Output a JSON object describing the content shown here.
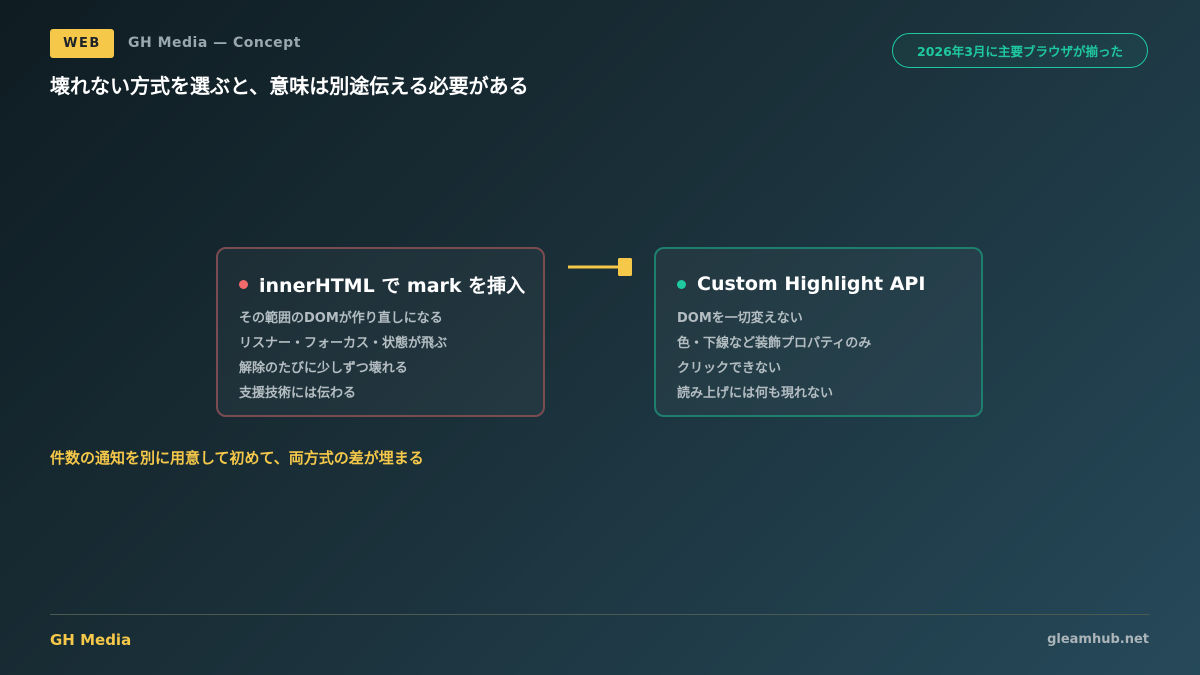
{
  "header": {
    "tag": "WEB",
    "source": "GH Media — Concept",
    "title": "壊れない方式を選ぶと、意味は別途伝える必要がある",
    "badge": "2026年3月に主要ブラウザが揃った"
  },
  "cards": {
    "left": {
      "title": "innerHTML で mark を挿入",
      "accent": "#f26b6b",
      "items": [
        "その範囲のDOMが作り直しになる",
        "リスナー・フォーカス・状態が飛ぶ",
        "解除のたびに少しずつ壊れる",
        "支援技術には伝わる"
      ]
    },
    "right": {
      "title": "Custom Highlight API",
      "accent": "#1fc9a0",
      "items": [
        "DOMを一切変えない",
        "色・下線など装飾プロパティのみ",
        "クリックできない",
        "読み上げには何も現れない"
      ]
    }
  },
  "note": "件数の通知を別に用意して初めて、両方式の差が埋まる",
  "footer": {
    "brand": "GH Media",
    "site": "gleamhub.net"
  },
  "colors": {
    "accent_yellow": "#f5c84a",
    "accent_green": "#1fc9a0",
    "accent_red": "#f26b6b"
  }
}
